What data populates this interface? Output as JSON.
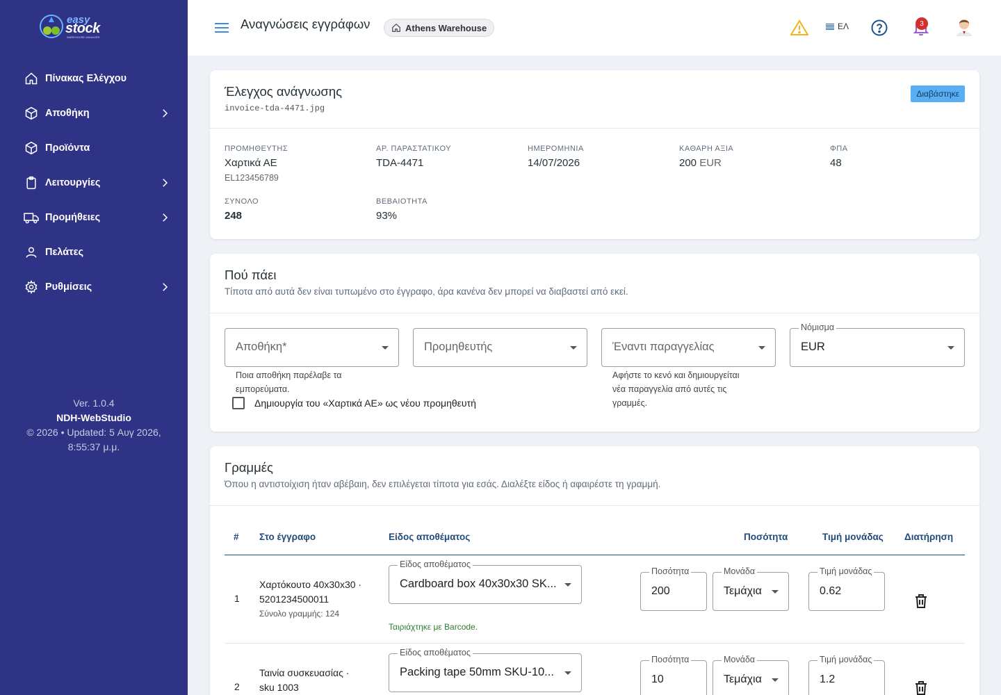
{
  "app": {
    "logo_easy": "easy",
    "logo_stock": "stock",
    "logo_tag": "WAREHOUSE MANAGER"
  },
  "sidebar": {
    "items": [
      {
        "label": "Πίνακας Ελέγχου",
        "icon": "home-icon"
      },
      {
        "label": "Αποθήκη",
        "icon": "cube-icon"
      },
      {
        "label": "Προϊόντα",
        "icon": "cube-icon"
      },
      {
        "label": "Λειτουργίες",
        "icon": "clipboard-icon"
      },
      {
        "label": "Προμήθειες",
        "icon": "truck-icon"
      },
      {
        "label": "Πελάτες",
        "icon": "user-icon"
      },
      {
        "label": "Ρυθμίσεις",
        "icon": "gear-icon"
      }
    ],
    "footer": {
      "version": "Ver. 1.0.4",
      "company": "NDH-WebStudio",
      "updated_line1": "© 2026 • Updated: 5 Αυγ 2026,",
      "updated_line2": "8:55:37 μ.μ."
    }
  },
  "header": {
    "title": "Αναγνώσεις εγγράφων",
    "warehouse_chip": "Athens Warehouse",
    "language": "ΕΛ",
    "notifications_count": "3"
  },
  "review": {
    "title": "Έλεγχος ανάγνωσης",
    "filename": "invoice-tda-4471.jpg",
    "status": "Διαβάστηκε",
    "fields": {
      "supplier_label": "ΠΡΟΜΗΘΕΥΤΗΣ",
      "supplier_value": "Χαρτικά ΑΕ",
      "supplier_vat": "EL123456789",
      "docno_label": "ΑΡ. ΠΑΡΑΣΤΑΤΙΚΟΥ",
      "docno_value": "TDA-4471",
      "date_label": "ΗΜΕΡΟΜΗΝΙΑ",
      "date_value": "14/07/2026",
      "net_label": "ΚΑΘΑΡΗ ΑΞΙΑ",
      "net_value": "200",
      "net_currency": "EUR",
      "vat_label": "ΦΠΑ",
      "vat_value": "48",
      "total_label": "ΣΥΝΟΛΟ",
      "total_value": "248",
      "confidence_label": "ΒΕΒΑΙΟΤΗΤΑ",
      "confidence_value": "93%"
    }
  },
  "destination": {
    "title": "Πού πάει",
    "subtitle": "Τίποτα από αυτά δεν είναι τυπωμένο στο έγγραφο, άρα κανένα δεν μπορεί να διαβαστεί από εκεί.",
    "warehouse_placeholder": "Αποθήκη*",
    "warehouse_helper_1": "Ποια αποθήκη παρέλαβε τα",
    "warehouse_helper_2": "εμπορεύματα.",
    "supplier_placeholder": "Προμηθευτής",
    "order_placeholder": "Έναντι παραγγελίας",
    "order_helper_1": "Αφήστε το κενό και δημιουργείται",
    "order_helper_2": "νέα παραγγελία από αυτές τις",
    "order_helper_3": "γραμμές.",
    "currency_label": "Νόμισμα",
    "currency_value": "EUR",
    "create_supplier_label": "Δημιουργία του «Χαρτικά ΑΕ» ως νέου προμηθευτή"
  },
  "lines": {
    "title": "Γραμμές",
    "subtitle": "Όπου η αντιστοίχιση ήταν αβέβαιη, δεν επιλέγεται τίποτα για εσάς. Διαλέξτε είδος ή αφαιρέστε τη γραμμή.",
    "columns": {
      "num": "#",
      "doc": "Στο έγγραφο",
      "item": "Είδος αποθέματος",
      "qty": "Ποσότητα",
      "price": "Τιμή μονάδας",
      "keep": "Διατήρηση"
    },
    "field_labels": {
      "item": "Είδος αποθέματος",
      "qty": "Ποσότητα",
      "unit": "Μονάδα",
      "price": "Τιμή μονάδας"
    },
    "rows": [
      {
        "num": "1",
        "doc_line1": "Χαρτόκουτο 40x30x30 ·",
        "doc_line2": "5201234500011",
        "doc_total": "Σύνολο γραμμής: 124",
        "item": "Cardboard box 40x30x30 SK...",
        "qty": "200",
        "unit": "Τεμάχια",
        "price": "0.62",
        "match_note": "Ταιριάχτηκε με Barcode."
      },
      {
        "num": "2",
        "doc_line1": "Ταινία συσκευασίας ·",
        "doc_line2": "sku 1003",
        "item": "Packing tape 50mm SKU-10...",
        "qty": "10",
        "unit": "Τεμάχια",
        "price": "1.2"
      }
    ]
  }
}
